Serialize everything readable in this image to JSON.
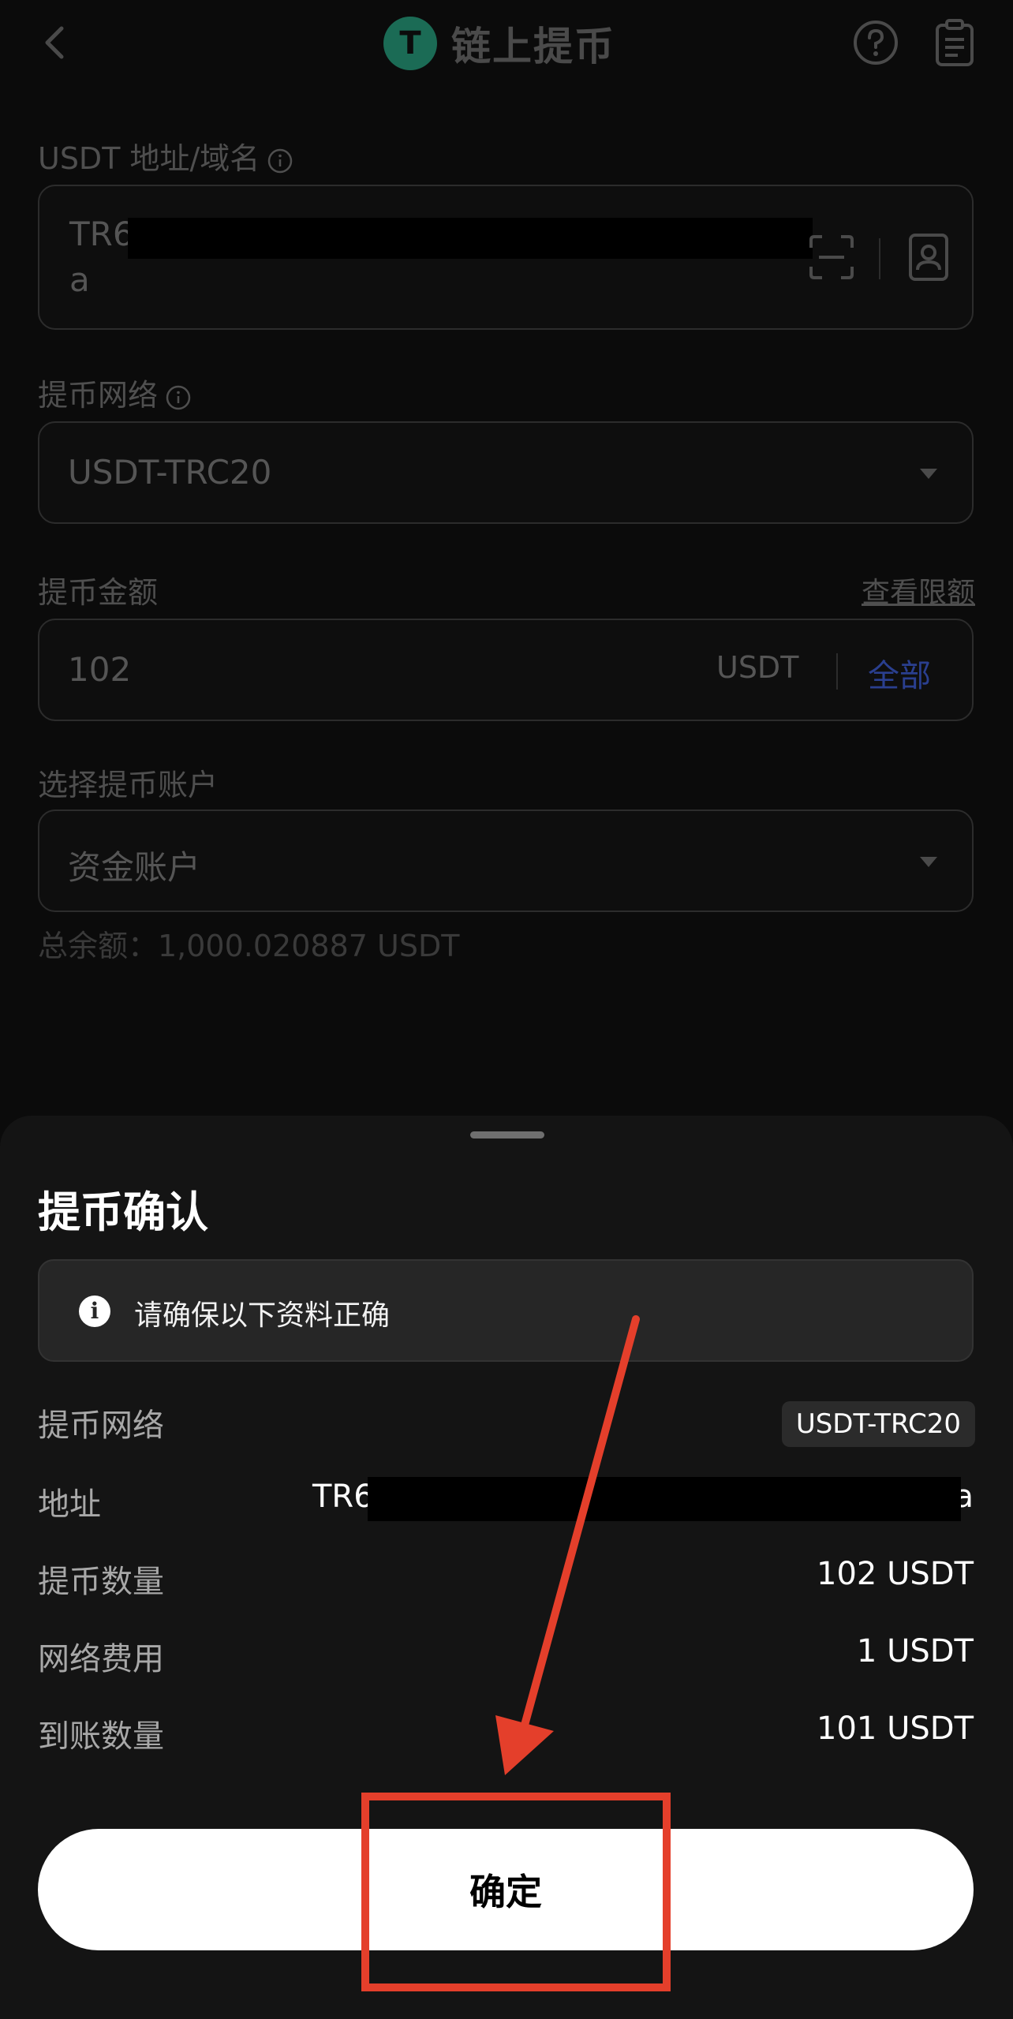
{
  "header": {
    "title": "链上提币",
    "coin_symbol": "T"
  },
  "address": {
    "label": "USDT 地址/域名",
    "value_line1": "TR6",
    "value_line2": "a"
  },
  "network": {
    "label": "提币网络",
    "value": "USDT-TRC20"
  },
  "amount": {
    "label": "提币金额",
    "limit_link": "查看限额",
    "value": "102",
    "unit": "USDT",
    "all_button": "全部"
  },
  "account": {
    "label": "选择提币账户",
    "value": "资金账户",
    "balance": "总余额：1,000.020887 USDT"
  },
  "sheet": {
    "title": "提币确认",
    "notice": "请确保以下资料正确",
    "rows": {
      "network_label": "提币网络",
      "network_value": "USDT-TRC20",
      "address_label": "地址",
      "address_prefix": "TR6",
      "address_suffix": "a",
      "quantity_label": "提币数量",
      "quantity_value": "102 USDT",
      "fee_label": "网络费用",
      "fee_value": "1 USDT",
      "received_label": "到账数量",
      "received_value": "101 USDT"
    },
    "confirm_label": "确定"
  },
  "colors": {
    "accent_blue": "#2a3f8f",
    "annotation_red": "#e43f2b",
    "coin_green": "#1b6b55"
  }
}
